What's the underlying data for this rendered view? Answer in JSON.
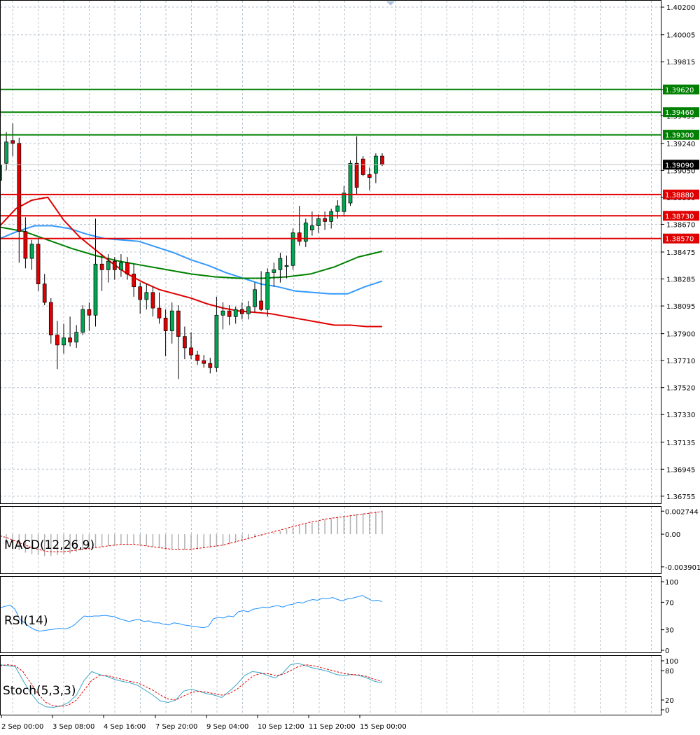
{
  "colors": {
    "bull": "#00a651",
    "bear": "#e00000",
    "grid": "#b8c4d0",
    "resistance": "#008000",
    "support": "#e00000",
    "ma_fast": "#e00000",
    "ma_mid": "#008000",
    "ma_slow": "#3399ff",
    "current": "#000000",
    "rsi": "#1e90ff",
    "stoch_main": "#3aa7c7",
    "stoch_signal": "#e00000",
    "macd_hist": "#b0b0b0",
    "macd_signal": "#e00000"
  },
  "chart_data": {
    "type": "candlestick",
    "price_axis": {
      "range": [
        1.367,
        1.4025
      ],
      "ticks": [
        "1.40200",
        "1.40005",
        "1.39815",
        "1.39620",
        "1.39435",
        "1.39240",
        "1.39050",
        "1.38860",
        "1.38670",
        "1.38475",
        "1.38285",
        "1.38095",
        "1.37900",
        "1.37710",
        "1.37520",
        "1.37330",
        "1.37135",
        "1.36945",
        "1.36755"
      ]
    },
    "time_axis": {
      "labels": [
        "2 Sep 00:00",
        "3 Sep 08:00",
        "4 Sep 16:00",
        "7 Sep 20:00",
        "9 Sep 04:00",
        "10 Sep 12:00",
        "11 Sep 20:00",
        "15 Sep 00:00"
      ]
    },
    "levels": [
      {
        "label": "1.39620",
        "value": 1.3962,
        "kind": "resistance"
      },
      {
        "label": "1.39460",
        "value": 1.3946,
        "kind": "resistance"
      },
      {
        "label": "1.39300",
        "value": 1.393,
        "kind": "resistance"
      },
      {
        "label": "1.38880",
        "value": 1.3888,
        "kind": "support"
      },
      {
        "label": "1.38730",
        "value": 1.3873,
        "kind": "support"
      },
      {
        "label": "1.38570",
        "value": 1.3857,
        "kind": "support"
      }
    ],
    "current_price": {
      "label": "1.39090",
      "value": 1.3909
    },
    "candles": [
      [
        1.3898,
        1.3911,
        1.3891,
        1.3909
      ],
      [
        1.391,
        1.3932,
        1.3905,
        1.3925
      ],
      [
        1.3926,
        1.3938,
        1.3915,
        1.3924
      ],
      [
        1.3924,
        1.3928,
        1.384,
        1.3862
      ],
      [
        1.3862,
        1.3872,
        1.3836,
        1.3843
      ],
      [
        1.3843,
        1.3856,
        1.3835,
        1.3853
      ],
      [
        1.3853,
        1.3857,
        1.382,
        1.3825
      ],
      [
        1.3825,
        1.3832,
        1.381,
        1.3812
      ],
      [
        1.3812,
        1.3815,
        1.3783,
        1.3789
      ],
      [
        1.3789,
        1.3799,
        1.3765,
        1.3782
      ],
      [
        1.3782,
        1.3797,
        1.3776,
        1.3787
      ],
      [
        1.3787,
        1.3802,
        1.3781,
        1.3784
      ],
      [
        1.3784,
        1.3796,
        1.378,
        1.3791
      ],
      [
        1.3791,
        1.381,
        1.3789,
        1.3807
      ],
      [
        1.3807,
        1.3812,
        1.3792,
        1.3803
      ],
      [
        1.3803,
        1.3871,
        1.3795,
        1.3839
      ],
      [
        1.3839,
        1.3846,
        1.382,
        1.3835
      ],
      [
        1.3835,
        1.3846,
        1.3826,
        1.3841
      ],
      [
        1.3841,
        1.3844,
        1.3828,
        1.3835
      ],
      [
        1.3835,
        1.3846,
        1.383,
        1.384
      ],
      [
        1.384,
        1.3844,
        1.3828,
        1.3832
      ],
      [
        1.3832,
        1.3839,
        1.3816,
        1.3823
      ],
      [
        1.3823,
        1.3826,
        1.3804,
        1.3814
      ],
      [
        1.3814,
        1.3825,
        1.3807,
        1.3819
      ],
      [
        1.3819,
        1.3823,
        1.3802,
        1.3808
      ],
      [
        1.3808,
        1.3819,
        1.3797,
        1.3801
      ],
      [
        1.3801,
        1.3807,
        1.3774,
        1.3792
      ],
      [
        1.3792,
        1.3812,
        1.3783,
        1.3806
      ],
      [
        1.3806,
        1.381,
        1.3758,
        1.3788
      ],
      [
        1.3788,
        1.3795,
        1.3772,
        1.378
      ],
      [
        1.378,
        1.3791,
        1.3772,
        1.3775
      ],
      [
        1.3775,
        1.3778,
        1.3768,
        1.3771
      ],
      [
        1.3771,
        1.3775,
        1.3766,
        1.3769
      ],
      [
        1.3769,
        1.3773,
        1.3762,
        1.3766
      ],
      [
        1.3766,
        1.3816,
        1.3763,
        1.3803
      ],
      [
        1.3803,
        1.3812,
        1.3793,
        1.3806
      ],
      [
        1.3806,
        1.381,
        1.3796,
        1.3802
      ],
      [
        1.3802,
        1.3809,
        1.3797,
        1.3807
      ],
      [
        1.3807,
        1.3812,
        1.38,
        1.3804
      ],
      [
        1.3804,
        1.3813,
        1.38,
        1.3809
      ],
      [
        1.3809,
        1.3826,
        1.3805,
        1.3821
      ],
      [
        1.3813,
        1.3834,
        1.3806,
        1.3807
      ],
      [
        1.3807,
        1.3836,
        1.3802,
        1.3833
      ],
      [
        1.3833,
        1.384,
        1.3823,
        1.3835
      ],
      [
        1.3835,
        1.3847,
        1.3826,
        1.3843
      ],
      [
        1.3838,
        1.3845,
        1.3829,
        1.3838
      ],
      [
        1.3838,
        1.3864,
        1.3835,
        1.3861
      ],
      [
        1.3861,
        1.388,
        1.3852,
        1.3855
      ],
      [
        1.3855,
        1.3871,
        1.3851,
        1.3868
      ],
      [
        1.3863,
        1.3876,
        1.3859,
        1.3866
      ],
      [
        1.3866,
        1.3874,
        1.3861,
        1.3871
      ],
      [
        1.3871,
        1.3876,
        1.3863,
        1.3869
      ],
      [
        1.3869,
        1.3878,
        1.3864,
        1.3876
      ],
      [
        1.3876,
        1.3884,
        1.3871,
        1.388
      ],
      [
        1.3876,
        1.3894,
        1.3873,
        1.3889
      ],
      [
        1.3882,
        1.3912,
        1.388,
        1.391
      ],
      [
        1.391,
        1.3929,
        1.3888,
        1.3893
      ],
      [
        1.3913,
        1.3915,
        1.3901,
        1.3902
      ],
      [
        1.3902,
        1.3907,
        1.3891,
        1.39
      ],
      [
        1.3903,
        1.3917,
        1.3896,
        1.3915
      ],
      [
        1.3915,
        1.3917,
        1.3908,
        1.3909
      ]
    ],
    "ma_fast": [
      1.3866,
      1.3878,
      1.3884,
      1.3886,
      1.387,
      1.3858,
      1.3849,
      1.384,
      1.3832,
      1.3826,
      1.3821,
      1.3818,
      1.3815,
      1.3811,
      1.3808,
      1.3806,
      1.3805,
      1.3804,
      1.3802,
      1.38,
      1.3798,
      1.3796,
      1.3796,
      1.3795,
      1.3795
    ],
    "ma_mid": [
      1.3865,
      1.3862,
      1.3856,
      1.385,
      1.3845,
      1.3841,
      1.3838,
      1.3835,
      1.3832,
      1.383,
      1.3829,
      1.3829,
      1.383,
      1.3832,
      1.3837,
      1.3844,
      1.3848
    ],
    "ma_slow": [
      1.3857,
      1.3862,
      1.3866,
      1.3866,
      1.3864,
      1.386,
      1.3857,
      1.3856,
      1.3855,
      1.3851,
      1.3847,
      1.3842,
      1.3838,
      1.3833,
      1.3829,
      1.3825,
      1.3823,
      1.382,
      1.3819,
      1.3818,
      1.3818,
      1.3823,
      1.3827
    ],
    "macd": {
      "label": "MACD(12,26,9)",
      "ticks": [
        "0.002744",
        "0.00",
        "-0.003901"
      ],
      "range": [
        -0.0045,
        0.0031
      ],
      "histogram": [
        -0.0009,
        -0.0012,
        -0.0015,
        -0.0019,
        -0.0022,
        -0.0024,
        -0.0025,
        -0.0026,
        -0.0026,
        -0.0025,
        -0.0024,
        -0.0023,
        -0.0021,
        -0.0019,
        -0.0017,
        -0.0016,
        -0.0015,
        -0.0014,
        -0.0013,
        -0.0012,
        -0.0012,
        -0.0012,
        -0.0013,
        -0.0014,
        -0.0015,
        -0.0016,
        -0.0017,
        -0.0018,
        -0.0019,
        -0.0019,
        -0.0019,
        -0.0018,
        -0.0017,
        -0.0016,
        -0.0015,
        -0.0014,
        -0.0012,
        -0.001,
        -0.0008,
        -0.0006,
        -0.0004,
        -0.0002,
        0.0,
        0.0002,
        0.0004,
        0.0006,
        0.0008,
        0.001,
        0.0012,
        0.0014,
        0.0016,
        0.0018,
        0.0019,
        0.0021,
        0.0022,
        0.0023,
        0.0024,
        0.0025,
        0.0026,
        0.0027,
        0.0028
      ],
      "signal": [
        -0.0002,
        -0.0004,
        -0.0007,
        -0.001,
        -0.0013,
        -0.0016,
        -0.0018,
        -0.002,
        -0.0021,
        -0.0021,
        -0.0021,
        -0.002,
        -0.0019,
        -0.0018,
        -0.0017,
        -0.0016,
        -0.0015,
        -0.0014,
        -0.0013,
        -0.0012,
        -0.0012,
        -0.0012,
        -0.0013,
        -0.0014,
        -0.0015,
        -0.0016,
        -0.0017,
        -0.0018,
        -0.0018,
        -0.0018,
        -0.0018,
        -0.0017,
        -0.0016,
        -0.0015,
        -0.0014,
        -0.0013,
        -0.0011,
        -0.0009,
        -0.0007,
        -0.0005,
        -0.0003,
        -0.0001,
        0.0001,
        0.0003,
        0.0005,
        0.0007,
        0.0009,
        0.0011,
        0.0013,
        0.0015,
        0.0016,
        0.0018,
        0.0019,
        0.002,
        0.0021,
        0.0022,
        0.0023,
        0.0024,
        0.0025,
        0.0026,
        0.0027
      ]
    },
    "rsi": {
      "label": "RSI(14)",
      "ticks": [
        "100",
        "70",
        "30",
        "0"
      ],
      "range": [
        0,
        100
      ],
      "values": [
        62,
        64,
        66,
        60,
        45,
        40,
        34,
        30,
        28,
        29,
        30,
        31,
        32,
        31,
        33,
        37,
        44,
        50,
        49,
        50,
        50,
        51,
        50,
        49,
        46,
        44,
        42,
        44,
        45,
        42,
        43,
        40,
        40,
        38,
        37,
        40,
        39,
        37,
        36,
        35,
        34,
        33,
        35,
        46,
        48,
        47,
        50,
        49,
        56,
        58,
        56,
        60,
        61,
        63,
        62,
        64,
        65,
        63,
        66,
        67,
        70,
        69,
        72,
        74,
        73,
        76,
        75,
        77,
        74,
        72,
        75,
        76,
        78,
        80,
        76,
        72,
        73,
        71
      ]
    },
    "stoch": {
      "label": "Stoch(5,3,3)",
      "ticks": [
        "100",
        "80",
        "20",
        "0"
      ],
      "range": [
        0,
        100
      ],
      "main": [
        92,
        90,
        88,
        60,
        35,
        15,
        6,
        5,
        8,
        15,
        30,
        60,
        78,
        72,
        68,
        62,
        58,
        55,
        50,
        40,
        30,
        18,
        15,
        20,
        38,
        42,
        38,
        33,
        30,
        25,
        38,
        52,
        70,
        78,
        76,
        70,
        65,
        75,
        92,
        95,
        90,
        85,
        82,
        78,
        72,
        70,
        72,
        70,
        65,
        58,
        55
      ],
      "signal": [
        90,
        92,
        90,
        78,
        55,
        32,
        15,
        8,
        7,
        10,
        20,
        40,
        60,
        70,
        70,
        66,
        62,
        58,
        55,
        48,
        40,
        30,
        22,
        20,
        28,
        35,
        38,
        36,
        33,
        30,
        33,
        42,
        55,
        68,
        74,
        74,
        70,
        72,
        80,
        88,
        92,
        90,
        86,
        82,
        78,
        74,
        72,
        71,
        68,
        62,
        58
      ]
    }
  }
}
